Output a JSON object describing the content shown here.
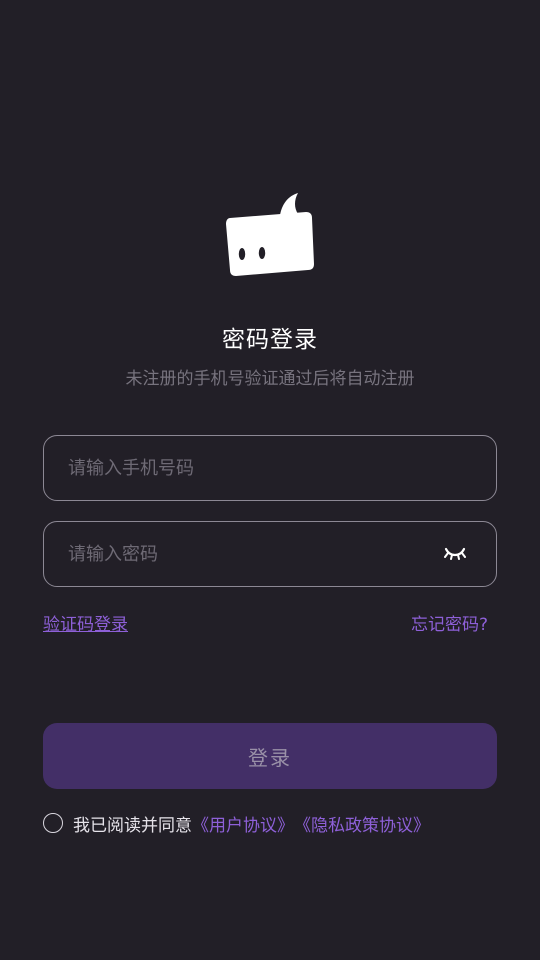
{
  "login": {
    "title": "密码登录",
    "subtitle": "未注册的手机号验证通过后将自动注册",
    "phone_placeholder": "请输入手机号码",
    "password_placeholder": "请输入密码",
    "sms_login_link": "验证码登录",
    "forgot_password_link": "忘记密码?",
    "submit_label": "登录",
    "agreement_text": "我已阅读并同意",
    "user_agreement_link": "《用户协议》",
    "privacy_policy_link": "《隐私政策协议》",
    "agreement_checked": false
  },
  "icons": {
    "logo": "speech-bubble-logo-icon",
    "password_visibility": "eye-closed-icon"
  },
  "colors": {
    "background": "#221f27",
    "accent": "#8e60d8",
    "button_bg": "#432f67"
  }
}
